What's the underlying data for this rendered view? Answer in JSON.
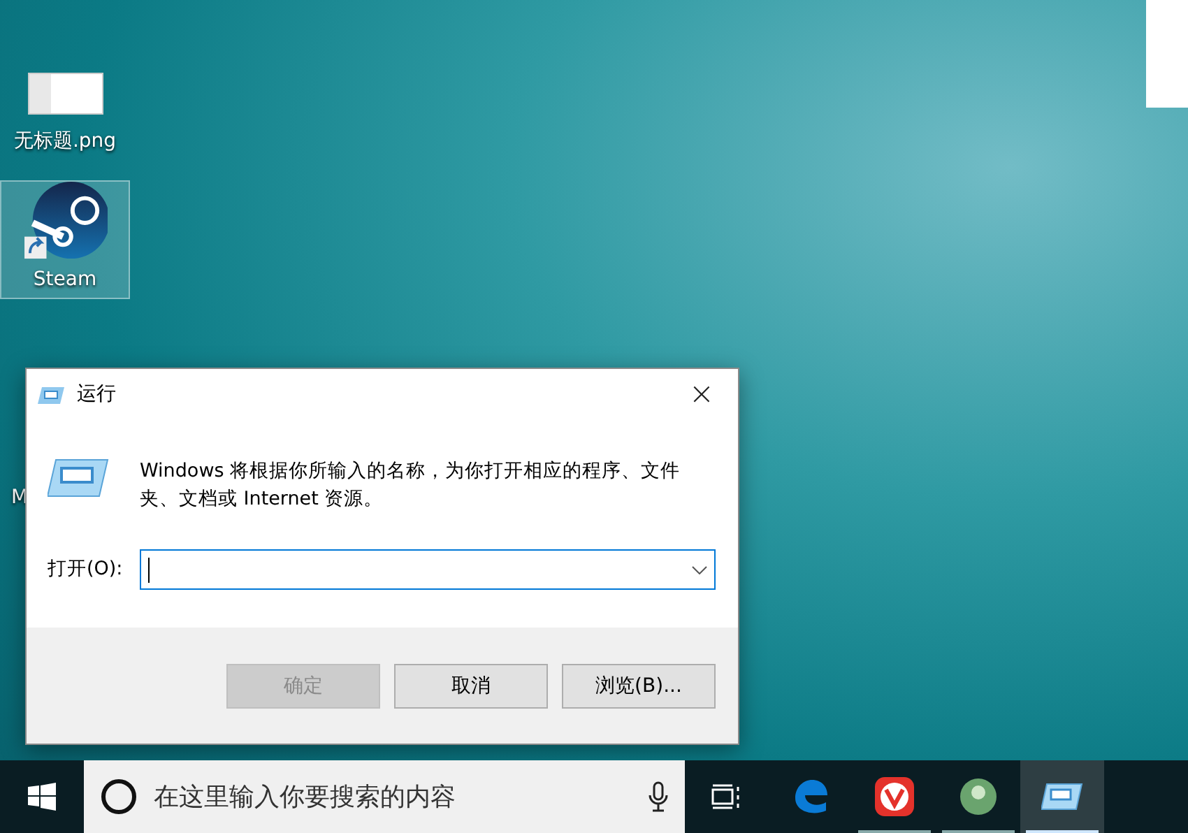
{
  "desktop_icons": [
    {
      "kind": "image",
      "label": "无标题.png",
      "selected": false
    },
    {
      "kind": "steam",
      "label": "Steam",
      "selected": true
    }
  ],
  "partial_label": "M",
  "dialog": {
    "title": "运行",
    "close": "×",
    "message": "Windows 将根据你所输入的名称，为你打开相应的程序、文件夹、文档或 Internet 资源。",
    "open_label": "打开(O):",
    "buttons": [
      {
        "label": "确定",
        "disabled": true
      },
      {
        "label": "取消",
        "disabled": false
      },
      {
        "label": "浏览(B)...",
        "disabled": false
      }
    ]
  },
  "taskbar": {
    "search_placeholder": "在这里输入你要搜索的内容",
    "apps": [
      {
        "kind": "edge",
        "running": false,
        "active": false
      },
      {
        "kind": "vivaldi",
        "running": true,
        "active": false
      },
      {
        "kind": "green",
        "running": true,
        "active": false
      },
      {
        "kind": "run",
        "running": true,
        "active": true
      }
    ]
  }
}
